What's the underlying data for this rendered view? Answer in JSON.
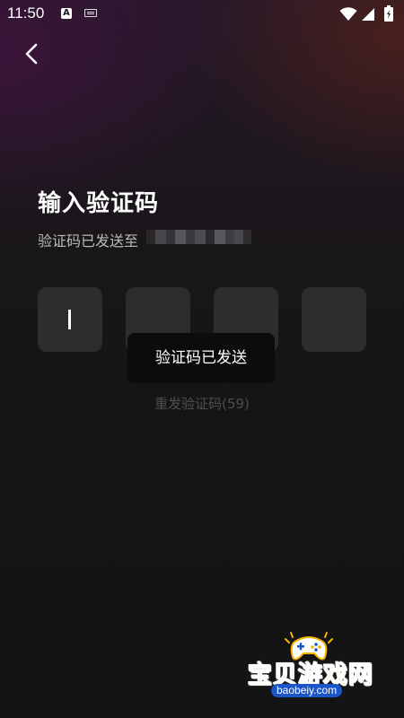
{
  "status_bar": {
    "time": "11:50",
    "a_icon_letter": "A",
    "icons": [
      "a-icon",
      "keyboard-icon",
      "wifi-icon",
      "signal-icon",
      "battery-icon"
    ]
  },
  "nav": {
    "back_icon": "chevron-left-icon"
  },
  "header": {
    "title": "输入验证码",
    "subtitle": "验证码已发送至"
  },
  "code_input": {
    "digits": [
      "",
      "",
      "",
      ""
    ],
    "active_index": 0
  },
  "toast": {
    "message": "验证码已发送"
  },
  "resend": {
    "label": "重发验证码(59)"
  },
  "watermark": {
    "text": "宝贝游戏网",
    "url": "baobeiy.com"
  },
  "colors": {
    "background": "#141414",
    "title": "#ffffff",
    "subtitle": "#b9b9bc",
    "code_box": "#2d2c2e",
    "toast_bg": "#0c0c0c",
    "resend_disabled": "#4e4e52",
    "watermark_text": "#f4b400",
    "watermark_url_bg": "#1a56c7"
  }
}
